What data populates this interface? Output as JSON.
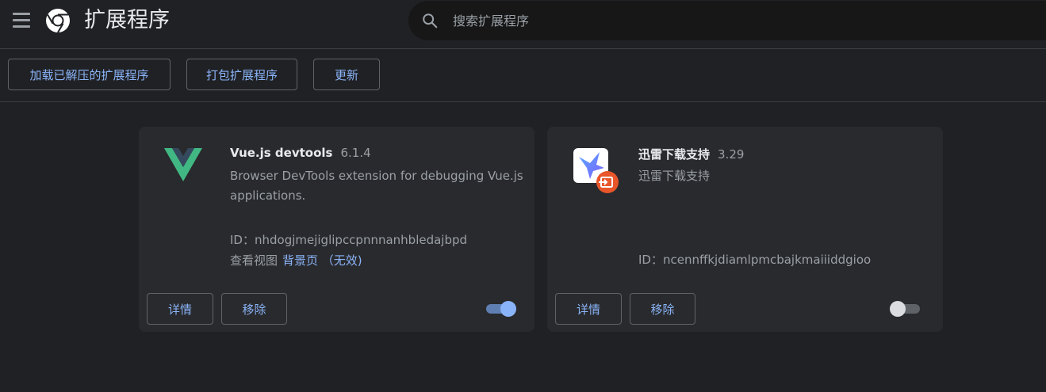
{
  "header": {
    "title": "扩展程序",
    "search_placeholder": "搜索扩展程序",
    "menu_icon": "hamburger-menu-icon",
    "logo_icon": "chrome-logo",
    "search_icon": "search-icon"
  },
  "toolbar": {
    "load_unpacked": "加载已解压的扩展程序",
    "pack_extension": "打包扩展程序",
    "update": "更新"
  },
  "extensions": [
    {
      "name": "Vue.js devtools",
      "version": "6.1.4",
      "description": "Browser DevTools extension for debugging Vue.js applications.",
      "id_label": "ID：",
      "id": "nhdogjmejiglipccpnnnanhbledajbpd",
      "views_label": "查看视图",
      "views_link": "背景页 （无效)",
      "details_label": "详情",
      "remove_label": "移除",
      "enabled": true,
      "icon": "vue-logo-icon"
    },
    {
      "name": "迅雷下载支持",
      "version": "3.29",
      "description": "迅雷下载支持",
      "id_label": "ID：",
      "id": "ncennffkjdiamlpmcbajkmaiiiddgioo",
      "details_label": "详情",
      "remove_label": "移除",
      "enabled": false,
      "icon": "xunlei-bird-icon"
    }
  ],
  "colors": {
    "background": "#202124",
    "card": "#292a2d",
    "accent": "#8ab4f8",
    "text_secondary": "#9aa0a6"
  }
}
